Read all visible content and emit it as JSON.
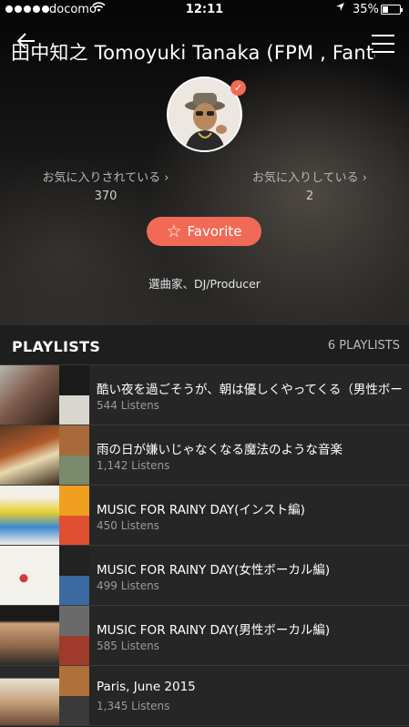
{
  "status_bar": {
    "carrier": "docomo",
    "time": "12:11",
    "battery": "35%"
  },
  "header": {
    "title": "田中知之  Tomoyuki Tanaka (FPM , Fantastic"
  },
  "profile": {
    "followers_label": "お気に入りされている ›",
    "followers_count": "370",
    "following_label": "お気に入りしている ›",
    "following_count": "2",
    "favorite_label": "Favorite",
    "bio": "選曲家、DJ/Producer"
  },
  "playlists": {
    "title": "PLAYLISTS",
    "count": "6 PLAYLISTS",
    "items": [
      {
        "name": "酷い夜を過ごそうが、朝は優しくやってくる（男性ボーカル編）",
        "listens": "544 Listens"
      },
      {
        "name": "雨の日が嫌いじゃなくなる魔法のような音楽",
        "listens": "1,142 Listens"
      },
      {
        "name": "MUSIC FOR RAINY DAY(インスト編)",
        "listens": "450 Listens"
      },
      {
        "name": "MUSIC FOR RAINY DAY(女性ボーカル編)",
        "listens": "499 Listens"
      },
      {
        "name": "MUSIC FOR RAINY DAY(男性ボーカル編)",
        "listens": "585 Listens"
      },
      {
        "name": "Paris, June 2015",
        "listens": "1,345 Listens"
      }
    ]
  },
  "colors": {
    "accent": "#f06a55",
    "list_bg": "#262626",
    "header_bg": "#1e1e1e"
  }
}
